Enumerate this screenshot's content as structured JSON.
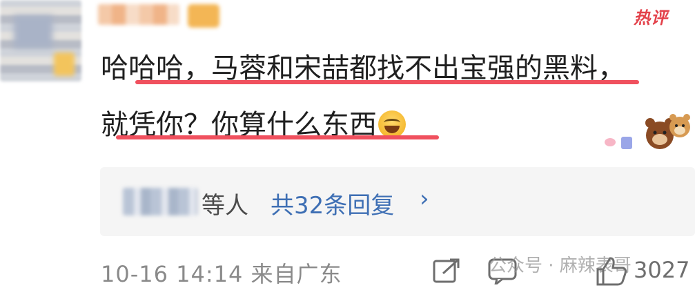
{
  "comment": {
    "username": "",
    "hot_label": "热评",
    "lines": [
      "哈哈哈，马蓉和宋喆都找不出宝强的黑料，",
      "就凭你？你算什么东西"
    ],
    "emoji_icon": "tears-of-joy-emoji"
  },
  "replies": {
    "others_label": "等人",
    "count_label": "共32条回复",
    "chevron": "›"
  },
  "meta": {
    "timestamp": "10-16 14:14 来自广东",
    "like_count": "3027",
    "watermark": "公众号 · 麻辣表哥"
  },
  "colors": {
    "accent_red": "#e3414a",
    "underline": "#f0505e",
    "link_blue": "#3e6fb4"
  }
}
